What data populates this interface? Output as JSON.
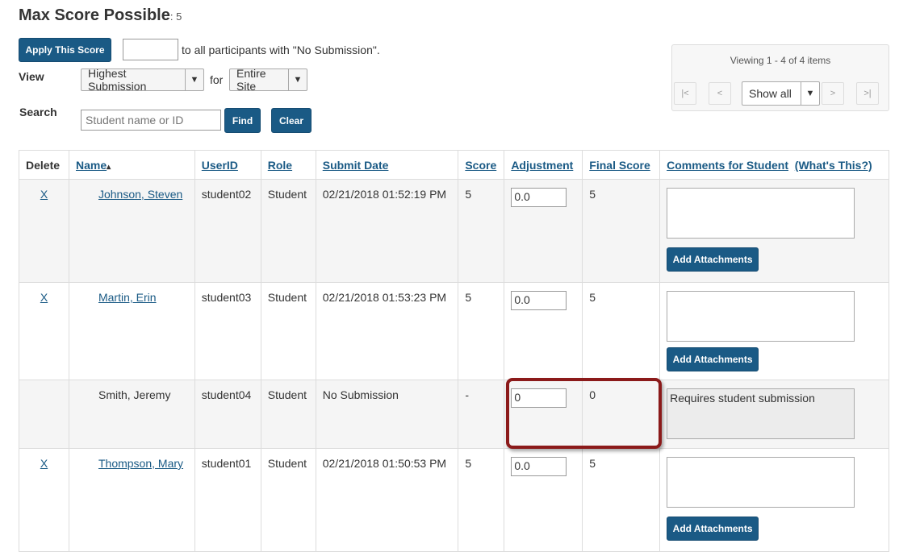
{
  "header": {
    "title": "Max Score Possible",
    "suffix": ": 5"
  },
  "apply": {
    "button": "Apply This Score",
    "input_value": "",
    "text": "to all participants with \"No Submission\"."
  },
  "view": {
    "label": "View",
    "submission_option": "Highest Submission",
    "for_text": "for",
    "site_option": "Entire Site"
  },
  "search": {
    "label": "Search",
    "placeholder": "Student name or ID",
    "find": "Find",
    "clear": "Clear"
  },
  "pager": {
    "status": "Viewing 1 - 4 of 4 items",
    "first": "|<",
    "prev": "<",
    "show": "Show all",
    "next": ">",
    "last": ">|"
  },
  "table": {
    "headers": {
      "delete": "Delete",
      "name": "Name",
      "sort_indicator": "▴",
      "userid": "UserID",
      "role": "Role",
      "submit_date": "Submit Date",
      "score": "Score",
      "adjustment": "Adjustment",
      "final_score": "Final Score",
      "comments": "Comments for Student",
      "whats_this": "(What's This?)"
    },
    "attach_label": "Add Attachments",
    "rows": [
      {
        "delete": "X",
        "name": "Johnson, Steven",
        "userid": "student02",
        "role": "Student",
        "submit_date": "02/21/2018 01:52:19 PM",
        "score": "5",
        "adjustment": "0.0",
        "final": "5",
        "comment": ""
      },
      {
        "delete": "X",
        "name": "Martin, Erin",
        "userid": "student03",
        "role": "Student",
        "submit_date": "02/21/2018 01:53:23 PM",
        "score": "5",
        "adjustment": "0.0",
        "final": "5",
        "comment": ""
      },
      {
        "delete": "",
        "name": "Smith, Jeremy",
        "userid": "student04",
        "role": "Student",
        "submit_date": "No Submission",
        "score": "-",
        "adjustment": "0",
        "final": "0",
        "comment": "Requires student submission"
      },
      {
        "delete": "X",
        "name": "Thompson, Mary",
        "userid": "student01",
        "role": "Student",
        "submit_date": "02/21/2018 01:50:53 PM",
        "score": "5",
        "adjustment": "0.0",
        "final": "5",
        "comment": ""
      }
    ]
  },
  "colors": {
    "primary_button": "#1a5a85",
    "highlight_border": "#8b1a1a",
    "link": "#1a5a85"
  }
}
